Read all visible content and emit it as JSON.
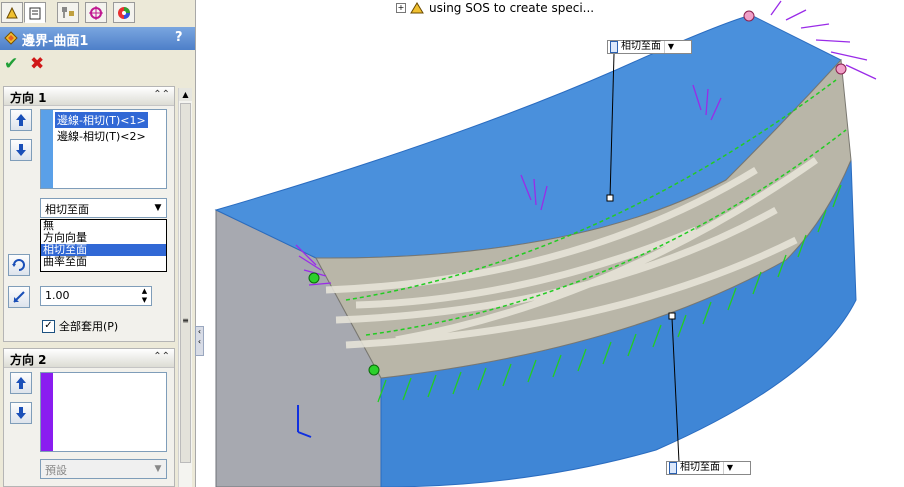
{
  "panel": {
    "title": "邊界-曲面1",
    "help": "?",
    "ok_symbol": "✔",
    "cancel_symbol": "✖",
    "direction1": {
      "title": "方向 1",
      "collapse_symbol": "⌃⌃",
      "items": [
        "邊線-相切(T)<1>",
        "邊線-相切(T)<2>"
      ],
      "strip_color": "#5aa0e8",
      "condition_selected": "相切至面",
      "condition_options": [
        "無",
        "方向向量",
        "相切至面",
        "曲率至面"
      ],
      "tangent_value": "1.00",
      "apply_all_label": "全部套用(P)",
      "apply_all_checked": "✓"
    },
    "direction2": {
      "title": "方向 2",
      "collapse_symbol": "⌃⌃",
      "strip_color": "#8a1df0",
      "condition_selected": "預設"
    }
  },
  "viewport": {
    "tree_label": "using SOS to create speci...",
    "callout_label": "相切至面"
  },
  "colors": {
    "selection": "#3168d5",
    "surface_blue": "#4a90dc",
    "wall_gray": "#a7a9b0",
    "tangent_green": "#22cc22",
    "curvature_purple": "#9a2be8"
  }
}
